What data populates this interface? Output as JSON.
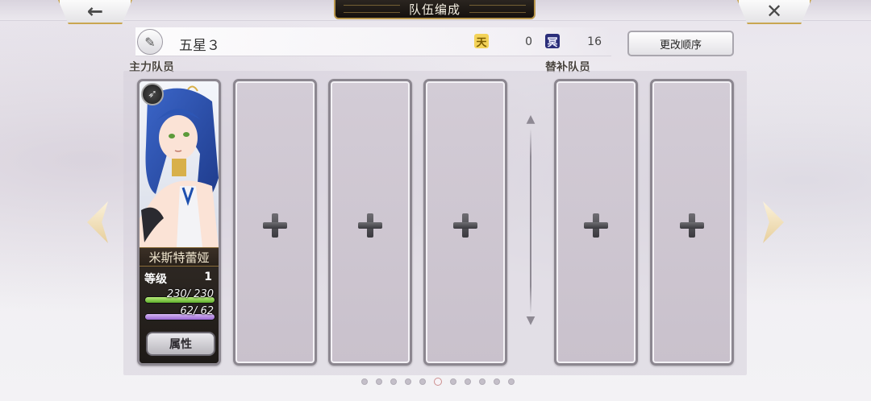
{
  "header": {
    "title": "队伍编成",
    "back_icon": "back-arrow-icon",
    "close_icon": "close-icon"
  },
  "team": {
    "name": "五星３",
    "sky_label": "天",
    "sky_value": "0",
    "nether_label": "冥",
    "nether_value": "16",
    "reorder_label": "更改顺序"
  },
  "sections": {
    "main_label": "主力队员",
    "sub_label": "替补队员"
  },
  "character": {
    "name": "米斯特蕾娅",
    "level_label": "等级",
    "level": "1",
    "hp_text": "230/ 230",
    "hp_fraction": 1.0,
    "mp_text": "62/ 62",
    "mp_fraction": 1.0,
    "attr_button_label": "属性"
  },
  "pagination": {
    "total": 11,
    "active_index": 5
  },
  "colors": {
    "frame_gold": "#c9a651",
    "hp_bar": "#7cc44a",
    "mp_bar": "#b48be0"
  }
}
